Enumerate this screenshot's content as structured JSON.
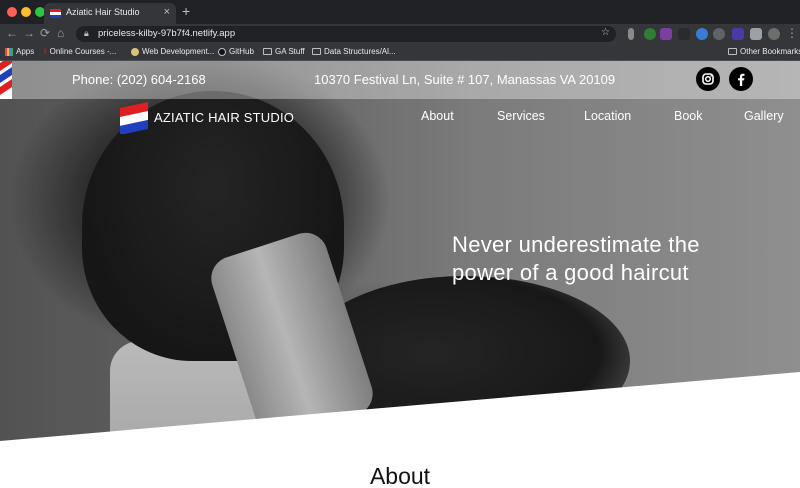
{
  "browser": {
    "tab_title": "Aziatic Hair Studio",
    "url": "priceless-kilby-97b7f4.netlify.app",
    "bookmarks": [
      {
        "label": "Apps"
      },
      {
        "label": "Online Courses -..."
      },
      {
        "label": "Web Development..."
      },
      {
        "label": "GitHub"
      },
      {
        "label": "GA Stuff"
      },
      {
        "label": "Data Structures/Al..."
      }
    ],
    "other_bookmarks": "Other Bookmarks"
  },
  "site": {
    "phone": "Phone: (202) 604-2168",
    "address": "10370 Festival Ln, Suite # 107, Manassas VA 20109",
    "brand": "AZIATIC HAIR STUDIO",
    "nav": [
      "About",
      "Services",
      "Location",
      "Book",
      "Gallery"
    ],
    "tagline_line1": "Never underestimate the",
    "tagline_line2": "power of a good haircut",
    "about_heading": "About",
    "social": [
      "instagram-icon",
      "facebook-icon"
    ],
    "brand_colors": {
      "red": "#e02020",
      "blue": "#1f3fbf",
      "white": "#ffffff"
    }
  }
}
